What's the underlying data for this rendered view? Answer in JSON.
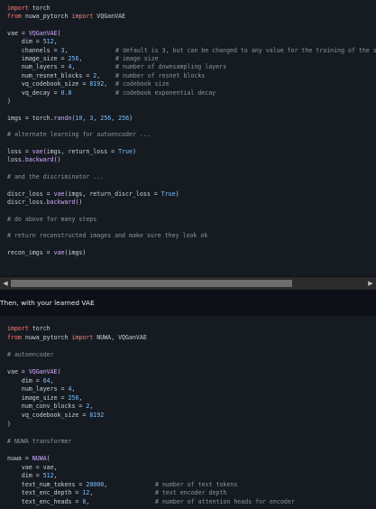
{
  "block1": {
    "lines": [
      [
        {
          "t": "import",
          "c": "kw"
        },
        {
          "t": " torch",
          "c": "var"
        }
      ],
      [
        {
          "t": "from",
          "c": "kw"
        },
        {
          "t": " nuwa_pytorch ",
          "c": "var"
        },
        {
          "t": "import",
          "c": "kw"
        },
        {
          "t": " VQGanVAE",
          "c": "var"
        }
      ],
      [],
      [
        {
          "t": "vae = ",
          "c": "var"
        },
        {
          "t": "VQGanVAE",
          "c": "cls"
        },
        {
          "t": "(",
          "c": "var"
        }
      ],
      [
        {
          "t": "    dim = ",
          "c": "var"
        },
        {
          "t": "512",
          "c": "num"
        },
        {
          "t": ",",
          "c": "var"
        }
      ],
      [
        {
          "t": "    channels = ",
          "c": "var"
        },
        {
          "t": "3",
          "c": "num"
        },
        {
          "t": ",",
          "c": "var"
        }
      ],
      [
        {
          "t": "    image_size = ",
          "c": "var"
        },
        {
          "t": "256",
          "c": "num"
        },
        {
          "t": ",",
          "c": "var"
        }
      ],
      [
        {
          "t": "    num_layers = ",
          "c": "var"
        },
        {
          "t": "4",
          "c": "num"
        },
        {
          "t": ",",
          "c": "var"
        }
      ],
      [
        {
          "t": "    num_resnet_blocks = ",
          "c": "var"
        },
        {
          "t": "2",
          "c": "num"
        },
        {
          "t": ",",
          "c": "var"
        }
      ],
      [
        {
          "t": "    vq_codebook_size = ",
          "c": "var"
        },
        {
          "t": "8192",
          "c": "num"
        },
        {
          "t": ",",
          "c": "var"
        }
      ],
      [
        {
          "t": "    vq_decay = ",
          "c": "var"
        },
        {
          "t": "0.8",
          "c": "num"
        }
      ],
      [
        {
          "t": ")",
          "c": "var"
        }
      ],
      [],
      [
        {
          "t": "imgs = torch.",
          "c": "var"
        },
        {
          "t": "randn",
          "c": "fn"
        },
        {
          "t": "(",
          "c": "var"
        },
        {
          "t": "10",
          "c": "num"
        },
        {
          "t": ", ",
          "c": "var"
        },
        {
          "t": "3",
          "c": "num"
        },
        {
          "t": ", ",
          "c": "var"
        },
        {
          "t": "256",
          "c": "num"
        },
        {
          "t": ", ",
          "c": "var"
        },
        {
          "t": "256",
          "c": "num"
        },
        {
          "t": ")",
          "c": "var"
        }
      ],
      [],
      [
        {
          "t": "# alternate learning for autoencoder ...",
          "c": "cmt"
        }
      ],
      [],
      [
        {
          "t": "loss = ",
          "c": "var"
        },
        {
          "t": "vae",
          "c": "fn"
        },
        {
          "t": "(imgs, return_loss = ",
          "c": "var"
        },
        {
          "t": "True",
          "c": "num"
        },
        {
          "t": ")",
          "c": "var"
        }
      ],
      [
        {
          "t": "loss.",
          "c": "var"
        },
        {
          "t": "backward",
          "c": "fn"
        },
        {
          "t": "()",
          "c": "var"
        }
      ],
      [],
      [
        {
          "t": "# and the discriminator ...",
          "c": "cmt"
        }
      ],
      [],
      [
        {
          "t": "discr_loss = ",
          "c": "var"
        },
        {
          "t": "vae",
          "c": "fn"
        },
        {
          "t": "(imgs, return_discr_loss = ",
          "c": "var"
        },
        {
          "t": "True",
          "c": "num"
        },
        {
          "t": ")",
          "c": "var"
        }
      ],
      [
        {
          "t": "discr_loss.",
          "c": "var"
        },
        {
          "t": "backward",
          "c": "fn"
        },
        {
          "t": "()",
          "c": "var"
        }
      ],
      [],
      [
        {
          "t": "# do above for many steps",
          "c": "cmt"
        }
      ],
      [],
      [
        {
          "t": "# return reconstructed images and make sure they look ok",
          "c": "cmt"
        }
      ],
      [],
      [
        {
          "t": "recon_imgs = ",
          "c": "var"
        },
        {
          "t": "vae",
          "c": "fn"
        },
        {
          "t": "(imgs)",
          "c": "var"
        }
      ]
    ],
    "comments": [
      {
        "line": 5,
        "text": "# default is 3, but can be changed to any value for the training of the segm"
      },
      {
        "line": 6,
        "text": "# image size"
      },
      {
        "line": 7,
        "text": "# number of downsampling layers"
      },
      {
        "line": 8,
        "text": "# number of resnet blocks"
      },
      {
        "line": 9,
        "text": "# codebook size"
      },
      {
        "line": 10,
        "text": "# codebook exponential decay"
      }
    ]
  },
  "scrollbar": {
    "left_arrow": "◀",
    "right_arrow": "▶"
  },
  "prose": {
    "text": "Then, with your learned VAE"
  },
  "block2": {
    "lines": [
      [
        {
          "t": "import",
          "c": "kw"
        },
        {
          "t": " torch",
          "c": "var"
        }
      ],
      [
        {
          "t": "from",
          "c": "kw"
        },
        {
          "t": " nuwa_pytorch ",
          "c": "var"
        },
        {
          "t": "import",
          "c": "kw"
        },
        {
          "t": " NUWA, VQGanVAE",
          "c": "var"
        }
      ],
      [],
      [
        {
          "t": "# autoencoder",
          "c": "cmt"
        }
      ],
      [],
      [
        {
          "t": "vae = ",
          "c": "var"
        },
        {
          "t": "VQGanVAE",
          "c": "cls"
        },
        {
          "t": "(",
          "c": "var"
        }
      ],
      [
        {
          "t": "    dim = ",
          "c": "var"
        },
        {
          "t": "64",
          "c": "num"
        },
        {
          "t": ",",
          "c": "var"
        }
      ],
      [
        {
          "t": "    num_layers = ",
          "c": "var"
        },
        {
          "t": "4",
          "c": "num"
        },
        {
          "t": ",",
          "c": "var"
        }
      ],
      [
        {
          "t": "    image_size = ",
          "c": "var"
        },
        {
          "t": "256",
          "c": "num"
        },
        {
          "t": ",",
          "c": "var"
        }
      ],
      [
        {
          "t": "    num_conv_blocks = ",
          "c": "var"
        },
        {
          "t": "2",
          "c": "num"
        },
        {
          "t": ",",
          "c": "var"
        }
      ],
      [
        {
          "t": "    vq_codebook_size = ",
          "c": "var"
        },
        {
          "t": "8192",
          "c": "num"
        }
      ],
      [
        {
          "t": ")",
          "c": "var"
        }
      ],
      [],
      [
        {
          "t": "# NUWA transformer",
          "c": "cmt"
        }
      ],
      [],
      [
        {
          "t": "nuwa = ",
          "c": "var"
        },
        {
          "t": "NUWA",
          "c": "cls"
        },
        {
          "t": "(",
          "c": "var"
        }
      ],
      [
        {
          "t": "    vae = vae,",
          "c": "var"
        }
      ],
      [
        {
          "t": "    dim = ",
          "c": "var"
        },
        {
          "t": "512",
          "c": "num"
        },
        {
          "t": ",",
          "c": "var"
        }
      ],
      [
        {
          "t": "    text_num_tokens = ",
          "c": "var"
        },
        {
          "t": "20000",
          "c": "num"
        },
        {
          "t": ",",
          "c": "var"
        }
      ],
      [
        {
          "t": "    text_enc_depth = ",
          "c": "var"
        },
        {
          "t": "12",
          "c": "num"
        },
        {
          "t": ",",
          "c": "var"
        }
      ],
      [
        {
          "t": "    text_enc_heads = ",
          "c": "var"
        },
        {
          "t": "8",
          "c": "num"
        },
        {
          "t": ",",
          "c": "var"
        }
      ]
    ],
    "comments": [
      {
        "line": 18,
        "text": "# number of text tokens"
      },
      {
        "line": 19,
        "text": "# text encoder depth"
      },
      {
        "line": 20,
        "text": "# number of attention heads for encoder"
      }
    ]
  }
}
